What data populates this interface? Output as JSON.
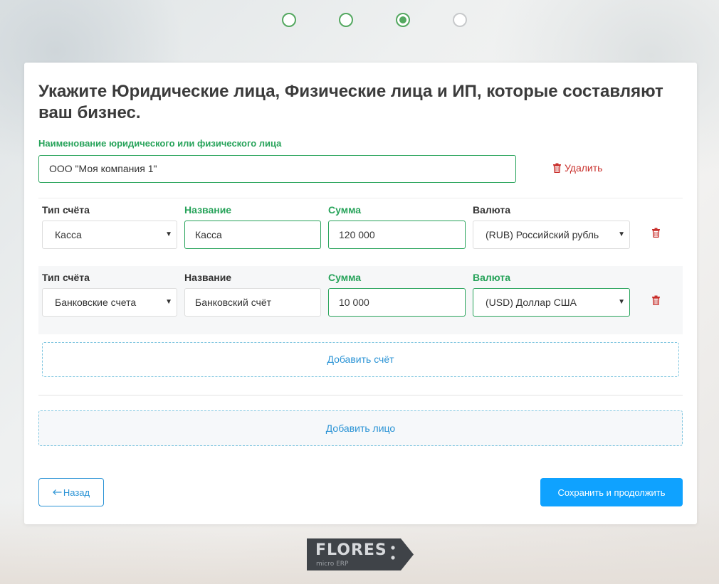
{
  "steps": [
    {
      "state": "done"
    },
    {
      "state": "done"
    },
    {
      "state": "current"
    },
    {
      "state": "pending"
    }
  ],
  "form": {
    "title": "Укажите Юридические лица, Физические лица и ИП, которые составляют ваш бизнес.",
    "entity_label": "Наименование юридического или физического лица",
    "entity_value": "ООО \"Моя компания 1\"",
    "delete_entity_label": "Удалить"
  },
  "accounts": [
    {
      "labels": {
        "type": "Тип счёта",
        "name": "Название",
        "amount": "Сумма",
        "currency": "Валюта"
      },
      "type": "Касса",
      "name": "Касса",
      "amount": "120 000",
      "currency": "(RUB) Российский рубль"
    },
    {
      "labels": {
        "type": "Тип счёта",
        "name": "Название",
        "amount": "Сумма",
        "currency": "Валюта"
      },
      "type": "Банковские счета",
      "name": "Банковский счёт",
      "amount": "10 000",
      "currency": "(USD) Доллар США"
    }
  ],
  "actions": {
    "add_account": "Добавить счёт",
    "add_person": "Добавить лицо",
    "back": "Назад",
    "save": "Сохранить и продолжить"
  },
  "logo": {
    "name": "FLORES",
    "tagline": "micro ERP"
  },
  "colors": {
    "green": "#27a35a",
    "step_green": "#54a860",
    "blue": "#2a93d5",
    "primary_button": "#0fa2ff",
    "danger": "#c9302c"
  },
  "icons": {
    "trash": "trash-icon",
    "back_arrow": "arrow-left-icon",
    "caret": "caret-down-icon"
  }
}
